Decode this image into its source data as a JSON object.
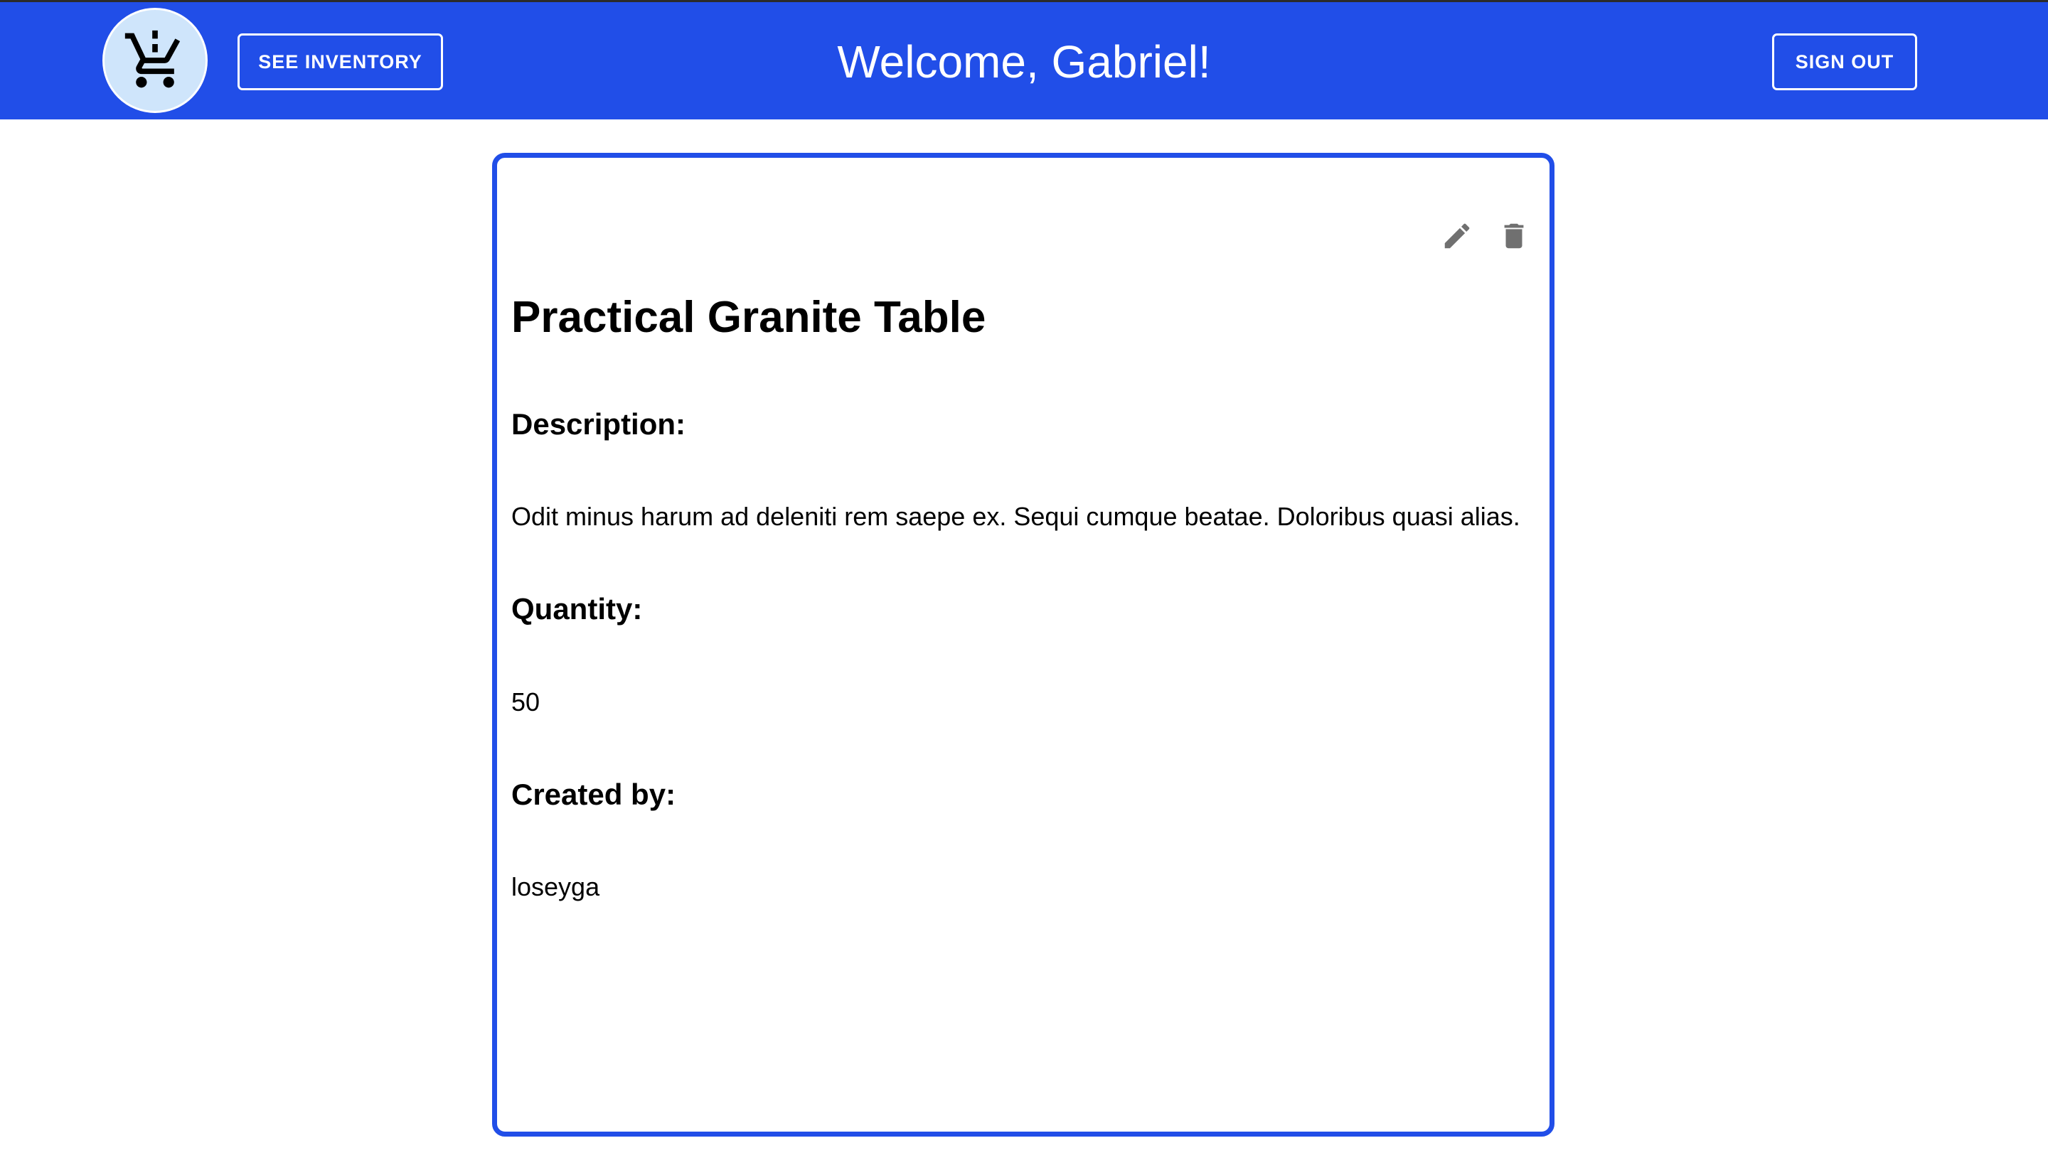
{
  "header": {
    "logo_icon": "shopping-cart-exclamation-icon",
    "see_inventory_label": "SEE INVENTORY",
    "welcome_text": "Welcome, Gabriel!",
    "sign_out_label": "SIGN OUT"
  },
  "item": {
    "title": "Practical Granite Table",
    "description_label": "Description:",
    "description": "Odit minus harum ad deleniti rem saepe ex. Sequi cumque beatae. Doloribus quasi alias.",
    "quantity_label": "Quantity:",
    "quantity": "50",
    "created_by_label": "Created by:",
    "created_by": "loseyga",
    "actions": {
      "edit_icon": "pencil-icon",
      "delete_icon": "trash-icon"
    }
  },
  "colors": {
    "header_bg": "#214ee8",
    "card_border": "#214ee8",
    "logo_bg": "#cfe5fb",
    "icon_gray": "#707070"
  }
}
